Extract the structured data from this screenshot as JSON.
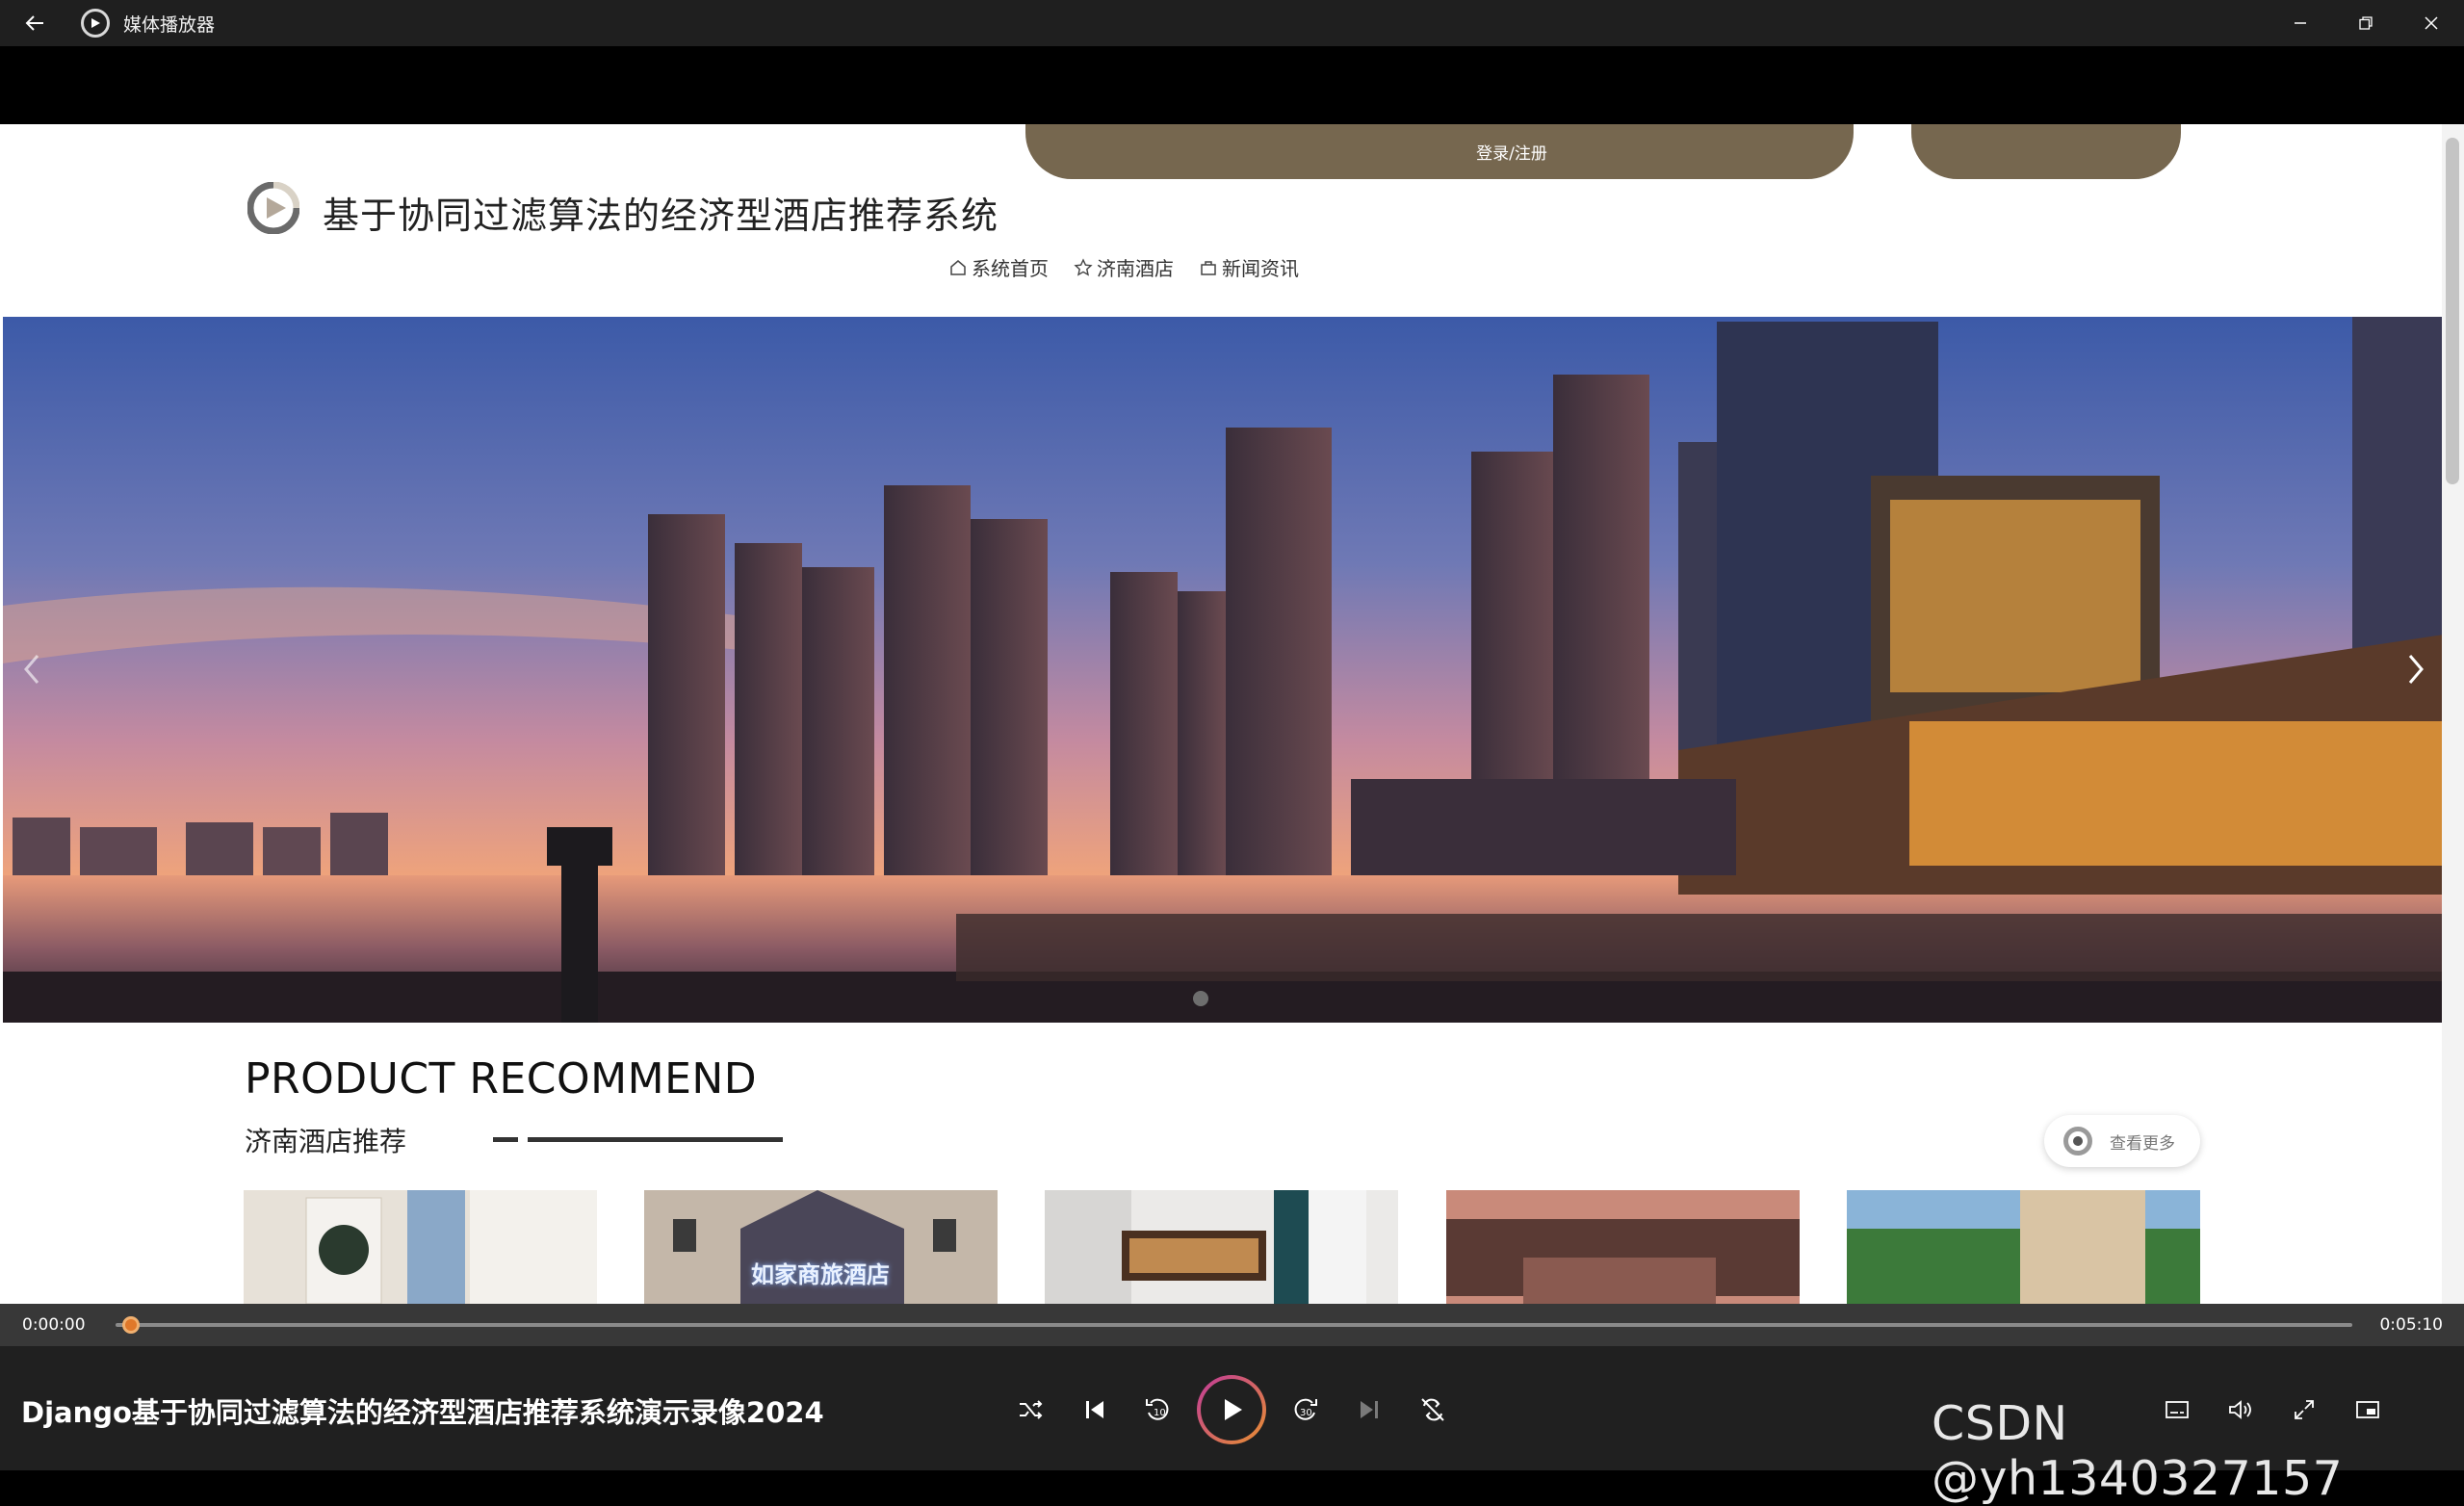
{
  "window": {
    "title": "媒体播放器"
  },
  "webpage": {
    "login_tab": "登录/注册",
    "site_title": "基于协同过滤算法的经济型酒店推荐系统",
    "nav": [
      {
        "label": "系统首页",
        "icon": "home-icon"
      },
      {
        "label": "济南酒店",
        "icon": "star-icon"
      },
      {
        "label": "新闻资讯",
        "icon": "bag-icon"
      }
    ],
    "section": {
      "title_en": "PRODUCT RECOMMEND",
      "title_cn": "济南酒店推荐",
      "more_label": "查看更多"
    },
    "cards": [
      {
        "sign": ""
      },
      {
        "sign": "如家商旅酒店"
      },
      {
        "sign": ""
      },
      {
        "sign": ""
      },
      {
        "sign": ""
      }
    ]
  },
  "player": {
    "current_time": "0:00:00",
    "total_time": "0:05:10",
    "progress": 0.0,
    "video_title": "Django基于协同过滤算法的经济型酒店推荐系统演示录像2024",
    "watermark": "CSDN @yh1340327157"
  },
  "colors": {
    "accent_brown": "#76674f",
    "player_bg": "#202020",
    "progress_thumb": "#e0782a"
  }
}
